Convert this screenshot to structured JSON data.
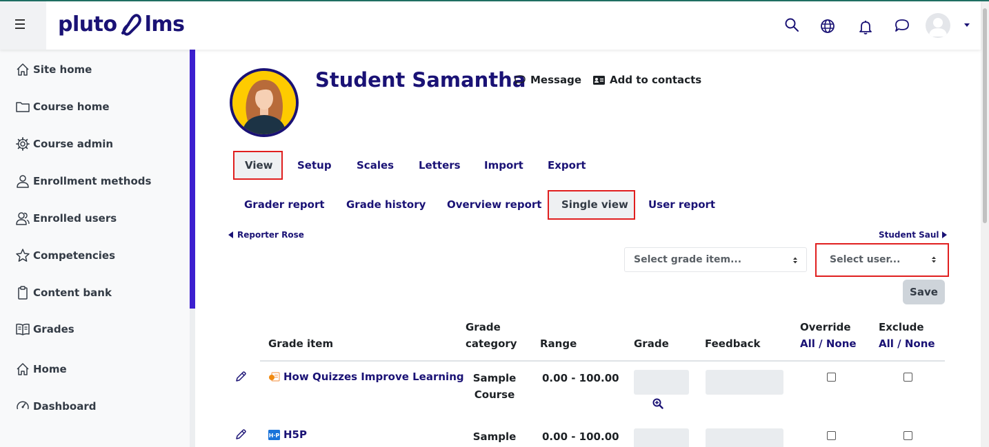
{
  "brand": {
    "name_left": "pluto",
    "name_right": "lms",
    "color": "#1a1275"
  },
  "navbar": {
    "icons": [
      "search-icon",
      "globe-icon",
      "bell-icon",
      "chat-icon",
      "user-avatar"
    ]
  },
  "sidebar": {
    "items": [
      {
        "label": "Site home",
        "icon": "house-icon"
      },
      {
        "label": "Course home",
        "icon": "folder-icon"
      },
      {
        "label": "Course admin",
        "icon": "gear-icon"
      },
      {
        "label": "Enrollment methods",
        "icon": "user-icon"
      },
      {
        "label": "Enrolled users",
        "icon": "users-icon"
      },
      {
        "label": "Competencies",
        "icon": "star-icon"
      },
      {
        "label": "Content bank",
        "icon": "clipboard-icon"
      },
      {
        "label": "Grades",
        "icon": "book-icon"
      },
      {
        "label": "Home",
        "icon": "house-icon"
      },
      {
        "label": "Dashboard",
        "icon": "dashboard-icon"
      }
    ]
  },
  "profile": {
    "name": "Student Samantha",
    "message_label": "Message",
    "add_contacts_label": "Add to contacts"
  },
  "tabs": {
    "primary": [
      "View",
      "Setup",
      "Scales",
      "Letters",
      "Import",
      "Export"
    ],
    "secondary": [
      "Grader report",
      "Grade history",
      "Overview report",
      "Single view",
      "User report"
    ],
    "active_primary": "View",
    "active_secondary": "Single view"
  },
  "pager": {
    "prev": "Reporter Rose",
    "next": "Student Saul"
  },
  "selects": {
    "grade_item": "Select grade item...",
    "user": "Select user..."
  },
  "save_label": "Save",
  "table": {
    "headers": {
      "grade_item": "Grade item",
      "grade_category_1": "Grade",
      "grade_category_2": "category",
      "range": "Range",
      "grade": "Grade",
      "feedback": "Feedback",
      "override": "Override",
      "exclude": "Exclude",
      "all": "All",
      "sep": "/",
      "none": "None"
    },
    "rows": [
      {
        "item": "How Quizzes Improve Learning",
        "icon": "quiz-icon",
        "category_1": "Sample",
        "category_2": "Course",
        "range": "0.00 - 100.00"
      },
      {
        "item": "H5P",
        "icon": "h5p-icon",
        "category_1": "Sample",
        "category_2": "",
        "range": "0.00 - 100.00"
      }
    ]
  }
}
